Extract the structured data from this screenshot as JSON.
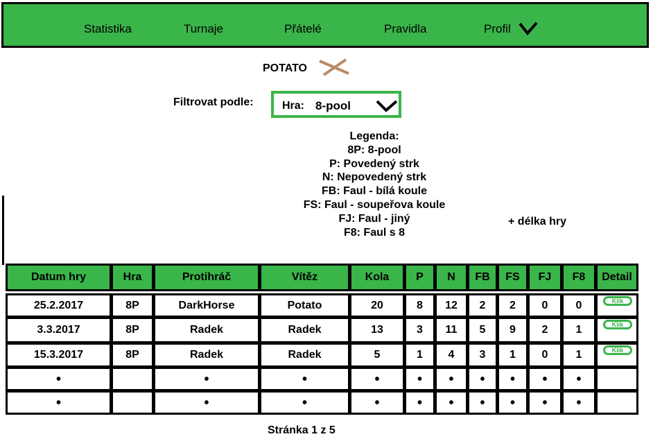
{
  "nav": {
    "items": [
      "Statistika",
      "Turnaje",
      "Přátelé",
      "Pravidla",
      "Profil"
    ],
    "profile_icon": "chevron-down-icon"
  },
  "user": {
    "name": "POTATO",
    "remove_icon": "close-icon"
  },
  "filter": {
    "label": "Filtrovat podle:",
    "prefix": "Hra:",
    "value": "8-pool",
    "icon": "chevron-down-icon"
  },
  "legend": {
    "lines": [
      "Legenda:",
      "8P: 8-pool",
      "P: Povedený strk",
      "N: Nepovedený strk",
      "FB: Faul - bílá koule",
      "FS: Faul - soupeřova koule",
      "FJ: Faul - jiný",
      "F8: Faul s 8"
    ],
    "extra": "+ délka hry"
  },
  "colors": {
    "accent": "#3ab54a",
    "border": "#000000",
    "background": "#ffffff"
  },
  "table": {
    "headers": [
      "Datum hry",
      "Hra",
      "Protihráč",
      "Vítěz",
      "Kola",
      "P",
      "N",
      "FB",
      "FS",
      "FJ",
      "F8",
      "Detail"
    ],
    "rows": [
      [
        "25.2.2017",
        "8P",
        "DarkHorse",
        "Potato",
        "20",
        "8",
        "12",
        "2",
        "2",
        "0",
        "0"
      ],
      [
        "3.3.2017",
        "8P",
        "Radek",
        "Radek",
        "13",
        "3",
        "11",
        "5",
        "9",
        "2",
        "1"
      ],
      [
        "15.3.2017",
        "8P",
        "Radek",
        "Radek",
        "5",
        "1",
        "4",
        "3",
        "1",
        "0",
        "1"
      ],
      [
        "•",
        "",
        "•",
        "•",
        "•",
        "•",
        "•",
        "•",
        "•",
        "•",
        "•"
      ],
      [
        "•",
        "",
        "•",
        "•",
        "•",
        "•",
        "•",
        "•",
        "•",
        "•",
        "•"
      ]
    ],
    "detail_button": "Klik"
  },
  "pager": {
    "text": "Stránka 1 z 5"
  }
}
